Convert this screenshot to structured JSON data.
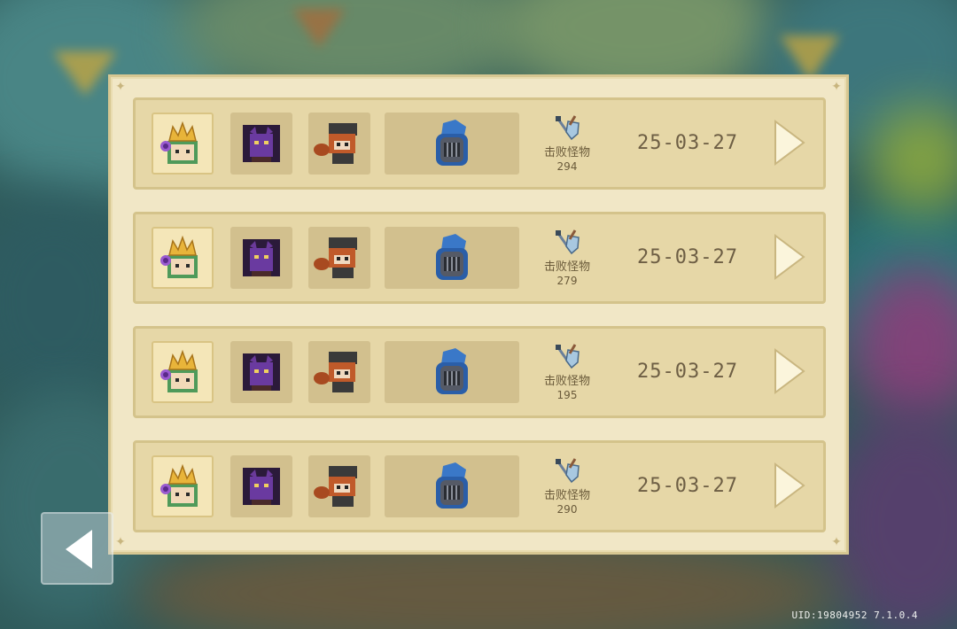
{
  "records": [
    {
      "stat_label": "击败怪物",
      "kills": "294",
      "date": "25-03-27"
    },
    {
      "stat_label": "击败怪物",
      "kills": "279",
      "date": "25-03-27"
    },
    {
      "stat_label": "击败怪物",
      "kills": "195",
      "date": "25-03-27"
    },
    {
      "stat_label": "击败怪物",
      "kills": "290",
      "date": "25-03-27"
    }
  ],
  "footer": {
    "uid_version": "UID:19804952 7.1.0.4"
  },
  "icons": {
    "slot1": "crowned-green-hero-icon",
    "slot2": "purple-beast-icon",
    "slot3": "raccoon-hero-icon",
    "pet": "blue-knight-helmet-icon",
    "stat": "crossed-sword-shield-icon",
    "go": "arrow-right-icon",
    "back": "arrow-left-icon"
  },
  "colors": {
    "panel": "#f1e7c6",
    "row": "#e6d7a7",
    "slot": "#d2c08e",
    "text": "#6d5e44"
  }
}
